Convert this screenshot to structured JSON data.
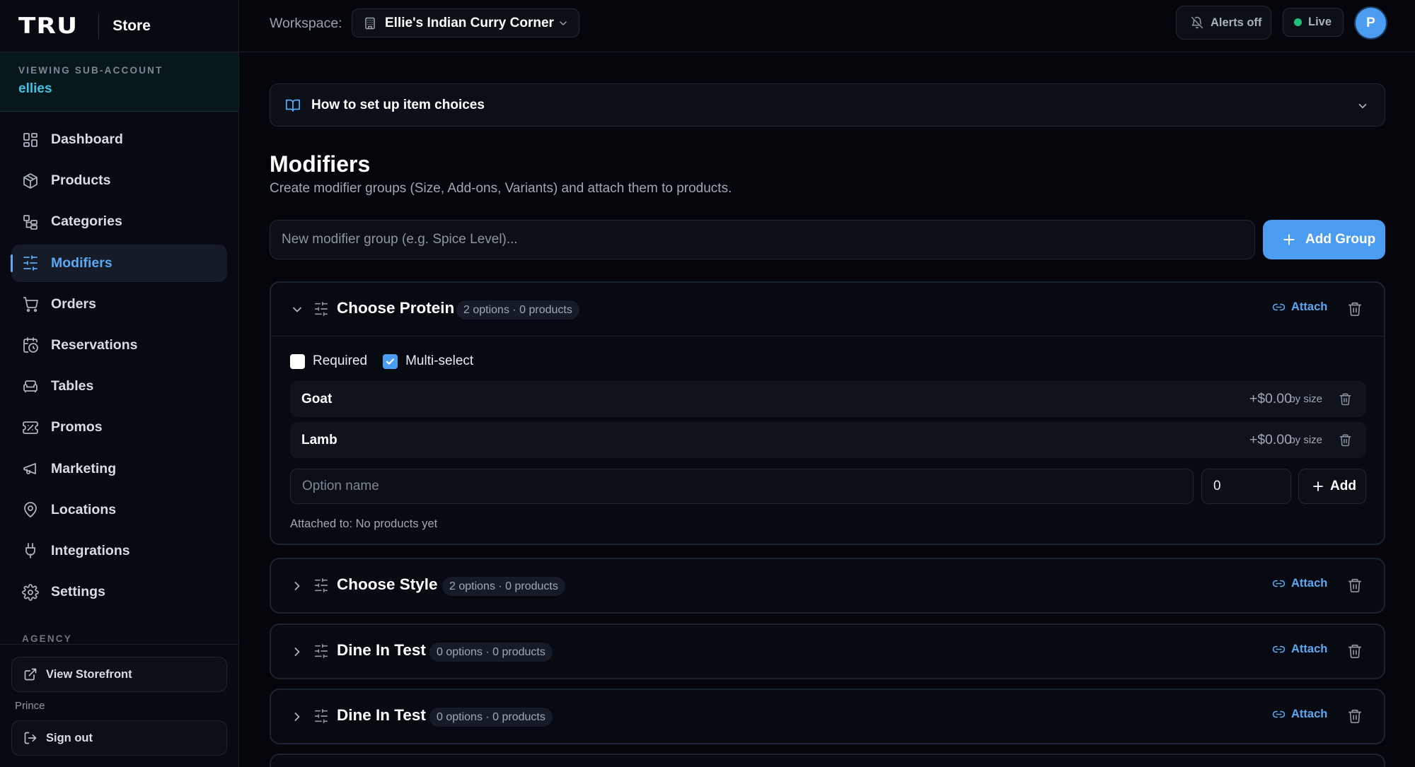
{
  "brand": {
    "logo": "TRU",
    "section": "Store"
  },
  "sub_account": {
    "label": "VIEWING SUB-ACCOUNT",
    "name": "ellies"
  },
  "nav": [
    {
      "label": "Dashboard",
      "icon": "dashboard-icon"
    },
    {
      "label": "Products",
      "icon": "box-icon"
    },
    {
      "label": "Categories",
      "icon": "categories-icon"
    },
    {
      "label": "Modifiers",
      "icon": "sliders-icon",
      "active": true
    },
    {
      "label": "Orders",
      "icon": "cart-icon"
    },
    {
      "label": "Reservations",
      "icon": "calendar-clock-icon"
    },
    {
      "label": "Tables",
      "icon": "armchair-icon"
    },
    {
      "label": "Promos",
      "icon": "ticket-icon"
    },
    {
      "label": "Marketing",
      "icon": "megaphone-icon"
    },
    {
      "label": "Locations",
      "icon": "map-pin-icon"
    },
    {
      "label": "Integrations",
      "icon": "plug-icon"
    },
    {
      "label": "Settings",
      "icon": "gear-icon"
    }
  ],
  "sidebar_footer": {
    "agency_label": "AGENCY",
    "view_storefront": "View Storefront",
    "user_name": "Prince",
    "sign_out": "Sign out"
  },
  "topbar": {
    "workspace_label": "Workspace:",
    "workspace_name": "Ellie's Indian Curry Corner",
    "alerts": "Alerts off",
    "live": "Live",
    "avatar_initial": "P"
  },
  "howto": {
    "title": "How to set up item choices"
  },
  "page": {
    "title": "Modifiers",
    "subtitle": "Create modifier groups (Size, Add-ons, Variants) and attach them to products.",
    "new_group_placeholder": "New modifier group (e.g. Spice Level)...",
    "add_group_label": "Add Group"
  },
  "groups": [
    {
      "name": "Choose Protein",
      "badge": "2 options · 0 products",
      "expanded": true,
      "attach_label": "Attach",
      "required_label": "Required",
      "required": false,
      "multiselect_label": "Multi-select",
      "multiselect": true,
      "options": [
        {
          "name": "Goat",
          "price": "+$0.00",
          "by_size": "by size"
        },
        {
          "name": "Lamb",
          "price": "+$0.00",
          "by_size": "by size"
        }
      ],
      "option_name_placeholder": "Option name",
      "price_value": "0",
      "add_option_label": "Add",
      "attached_to": "Attached to: No products yet"
    },
    {
      "name": "Choose Style",
      "badge": "2 options · 0 products",
      "expanded": false,
      "attach_label": "Attach"
    },
    {
      "name": "Dine In Test",
      "badge": "0 options · 0 products",
      "expanded": false,
      "attach_label": "Attach"
    },
    {
      "name": "Dine In Test",
      "badge": "0 options · 0 products",
      "expanded": false,
      "attach_label": "Attach"
    }
  ],
  "colors": {
    "accent": "#4a9df0",
    "link": "#5aa9f5",
    "sub_account": "#3cc2e4",
    "live_dot": "#21c07a",
    "background": "#04060b"
  }
}
